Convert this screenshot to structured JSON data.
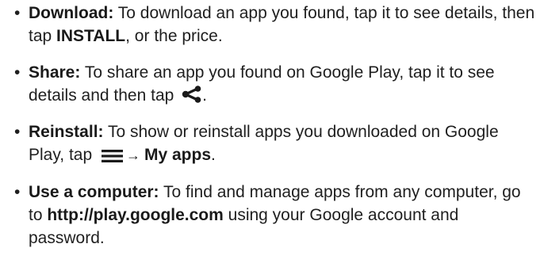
{
  "bullet": "•",
  "items": [
    {
      "title": "Download:",
      "text_before": " To download an app you found, tap it to see details, then tap ",
      "bold_action": "INSTALL",
      "text_after": ", or the price."
    },
    {
      "title": "Share:",
      "text_before": " To share an app you found on Google Play, tap it to see details and then tap ",
      "icon": "share-icon",
      "text_after": "."
    },
    {
      "title": "Reinstall:",
      "text_before": " To show or reinstall apps you downloaded on Google Play, tap ",
      "icon": "menu-icon",
      "arrow": "→",
      "bold_action": "My apps",
      "text_after": "."
    },
    {
      "title": "Use a computer:",
      "text_before": " To find and manage apps from any computer, go to ",
      "link": "http://play.google.com",
      "text_after": " using your Google account and password."
    }
  ]
}
